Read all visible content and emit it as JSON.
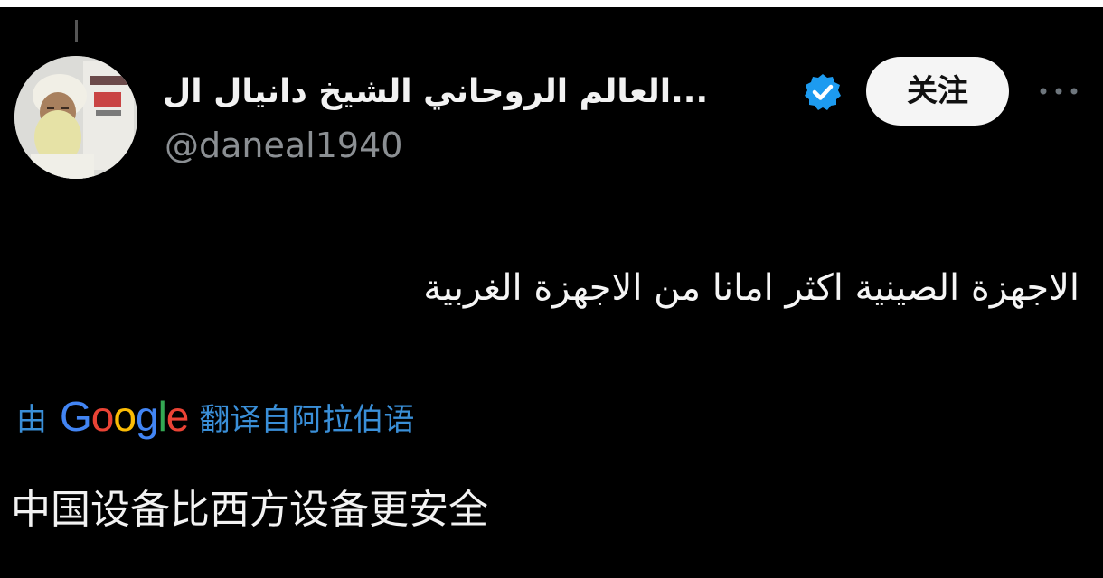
{
  "tweet": {
    "display_name": "العالم الروحاني الشيخ دانيال ال...",
    "handle": "@daneal1940",
    "follow_label": "关注",
    "text": "الاجهزة الصينية اكثر امانا من الاجهزة الغربية",
    "translation": {
      "prefix": "由",
      "logo_text": "Google",
      "suffix": "翻译自阿拉伯语",
      "text": "中国设备比西方设备更安全"
    }
  },
  "colors": {
    "background": "#000000",
    "verified_badge": "#1d9bf0",
    "translate_link": "#3a8fd8",
    "handle_gray": "#8b8f93"
  },
  "icons": {
    "verified": "verified-badge-icon",
    "more": "more-options-icon"
  }
}
